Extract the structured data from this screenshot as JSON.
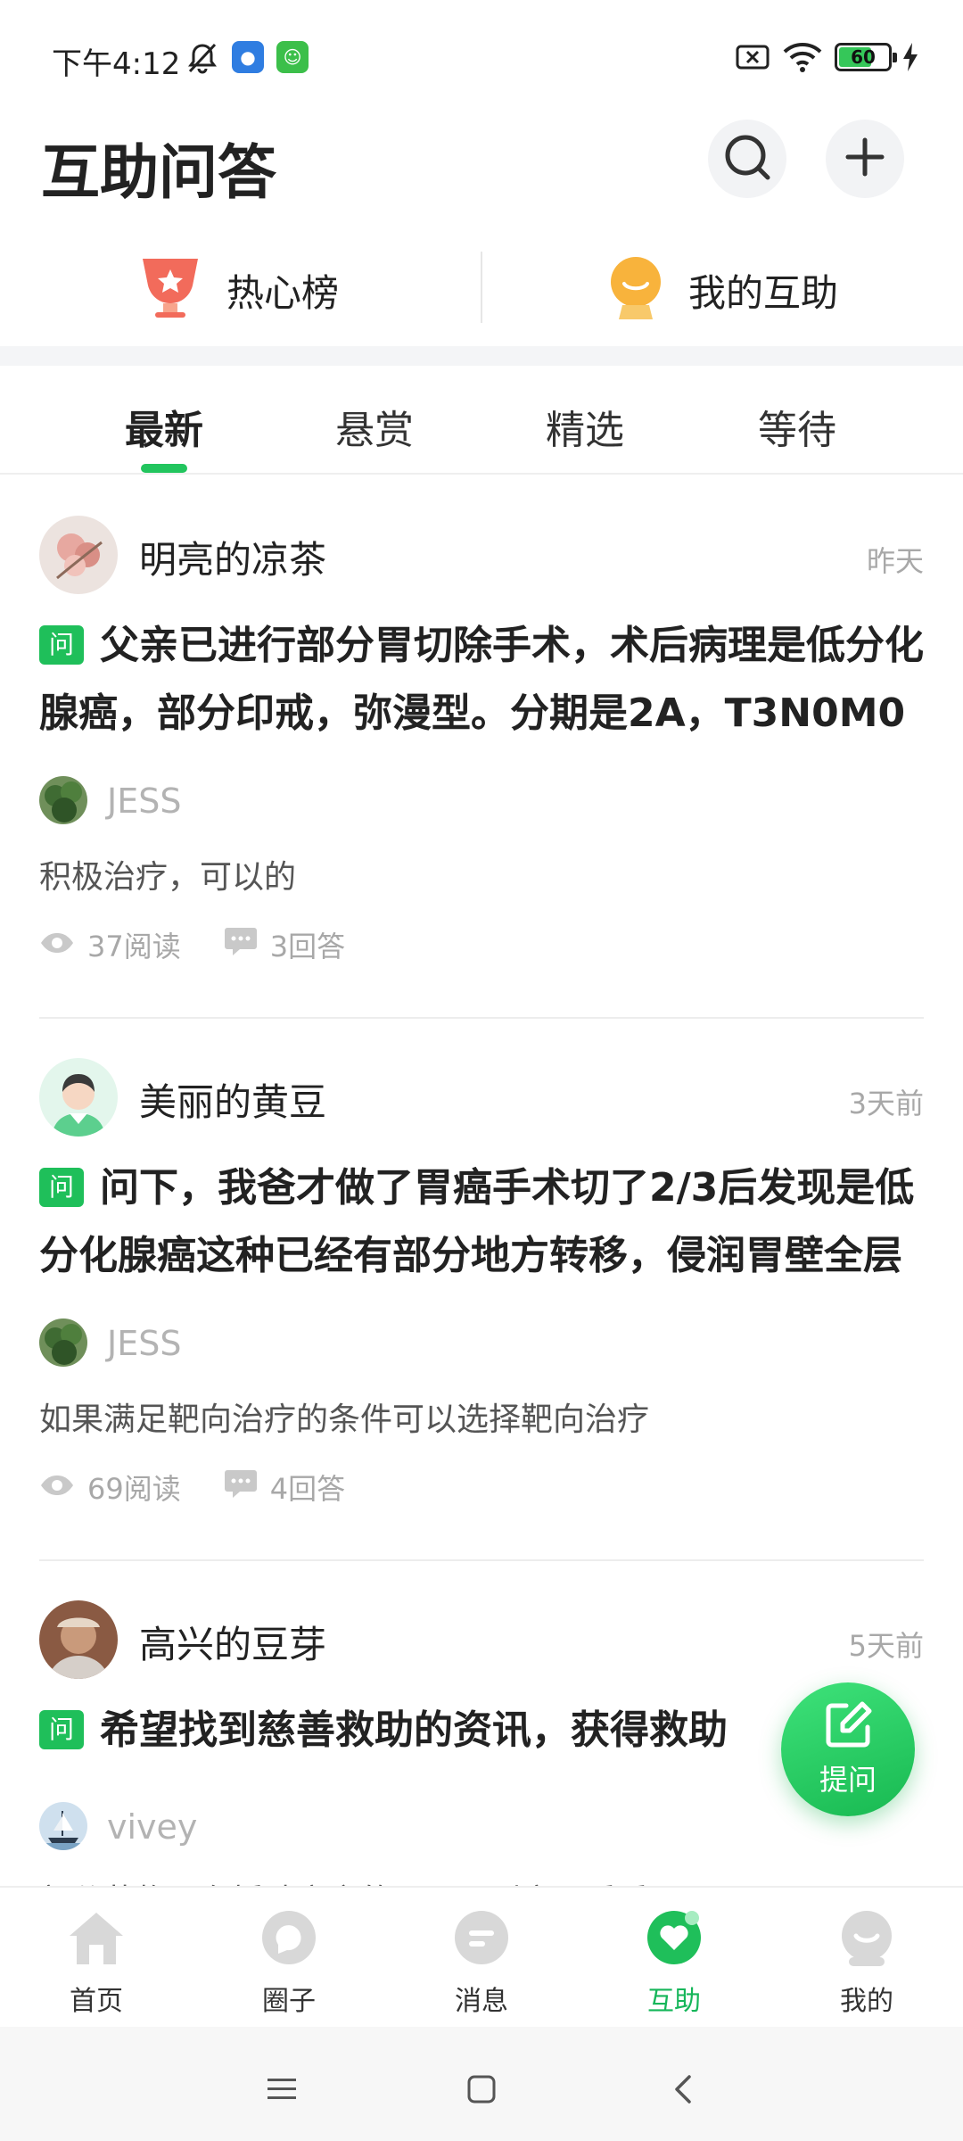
{
  "status_bar": {
    "time": "下午4:12",
    "battery_level": "60",
    "icons": [
      "bell-off-icon",
      "app-notification-icon",
      "android-icon",
      "sim-no-service-icon",
      "wifi-icon",
      "battery-icon",
      "charging-bolt-icon"
    ]
  },
  "header": {
    "title": "互助问答",
    "search_icon": "search-icon",
    "add_icon": "plus-icon"
  },
  "quick_links": [
    {
      "label": "热心榜",
      "icon": "trophy-icon"
    },
    {
      "label": "我的互助",
      "icon": "smile-icon"
    }
  ],
  "tabs": [
    {
      "label": "最新",
      "active": true
    },
    {
      "label": "悬赏",
      "active": false
    },
    {
      "label": "精选",
      "active": false
    },
    {
      "label": "等待",
      "active": false
    }
  ],
  "feed": [
    {
      "user": "明亮的凉茶",
      "time": "昨天",
      "badge": "问",
      "question": "父亲已进行部分胃切除手术，术后病理是低分化腺癌，部分印戒，弥漫型。分期是2A，T3N0M0",
      "answerer": "JESS",
      "answer": "积极治疗，可以的",
      "reads": "37阅读",
      "answers": "3回答"
    },
    {
      "user": "美丽的黄豆",
      "time": "3天前",
      "badge": "问",
      "question": "问下，我爸才做了胃癌手术切了2/3后发现是低分化腺癌这种已经有部分地方转移，侵润胃壁全层",
      "answerer": "JESS",
      "answer": "如果满足靶向治疗的条件可以选择靶向治疗",
      "reads": "69阅读",
      "answers": "4回答"
    },
    {
      "user": "高兴的豆芽",
      "time": "5天前",
      "badge": "问",
      "question": "希望找到慈善救助的资讯，获得救助",
      "answerer": "vivey",
      "answer": "部分药物是有援助方案的，可以到官网看看",
      "reads": "",
      "answers": ""
    }
  ],
  "fab": {
    "label": "提问",
    "icon": "edit-icon"
  },
  "bottom_nav": [
    {
      "label": "首页",
      "icon": "home-icon",
      "active": false
    },
    {
      "label": "圈子",
      "icon": "circle-chat-icon",
      "active": false
    },
    {
      "label": "消息",
      "icon": "message-icon",
      "active": false
    },
    {
      "label": "互助",
      "icon": "heart-icon",
      "active": true
    },
    {
      "label": "我的",
      "icon": "profile-icon",
      "active": false
    }
  ],
  "system_nav": [
    "menu-icon",
    "home-square-icon",
    "back-icon"
  ],
  "colors": {
    "accent": "#1fbf5a",
    "muted_text": "#a8a8a8",
    "nav_inactive": "#d8d8d8"
  }
}
